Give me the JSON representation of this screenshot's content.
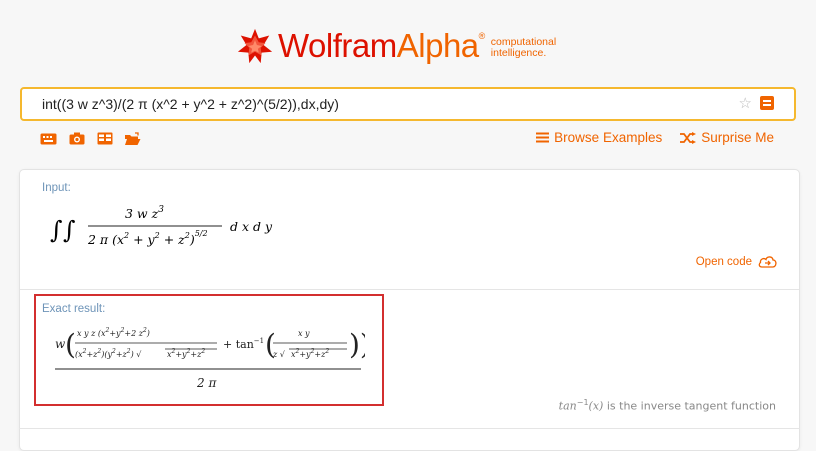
{
  "brand": {
    "name_part1": "Wolfram",
    "name_part2": "Alpha",
    "tagline_line1": "computational",
    "tagline_line2": "intelligence."
  },
  "search": {
    "query": "int((3 w z^3)/(2 π (x^2 + y^2 + z^2)^(5/2)),dx,dy)"
  },
  "nav": {
    "browse_examples": "Browse Examples",
    "surprise_me": "Surprise Me"
  },
  "pods": {
    "input_label": "Input:",
    "open_code": "Open code",
    "exact_label": "Exact result:",
    "footnote_fn": "tan",
    "footnote_sup": "−1",
    "footnote_arg": "(x)",
    "footnote_text": "is the inverse tangent function"
  },
  "colors": {
    "accent": "#f06400",
    "brand_red": "#dd1100",
    "search_border": "#f5b82e",
    "label_blue": "#6e94b8",
    "highlight": "#d32f2f"
  }
}
